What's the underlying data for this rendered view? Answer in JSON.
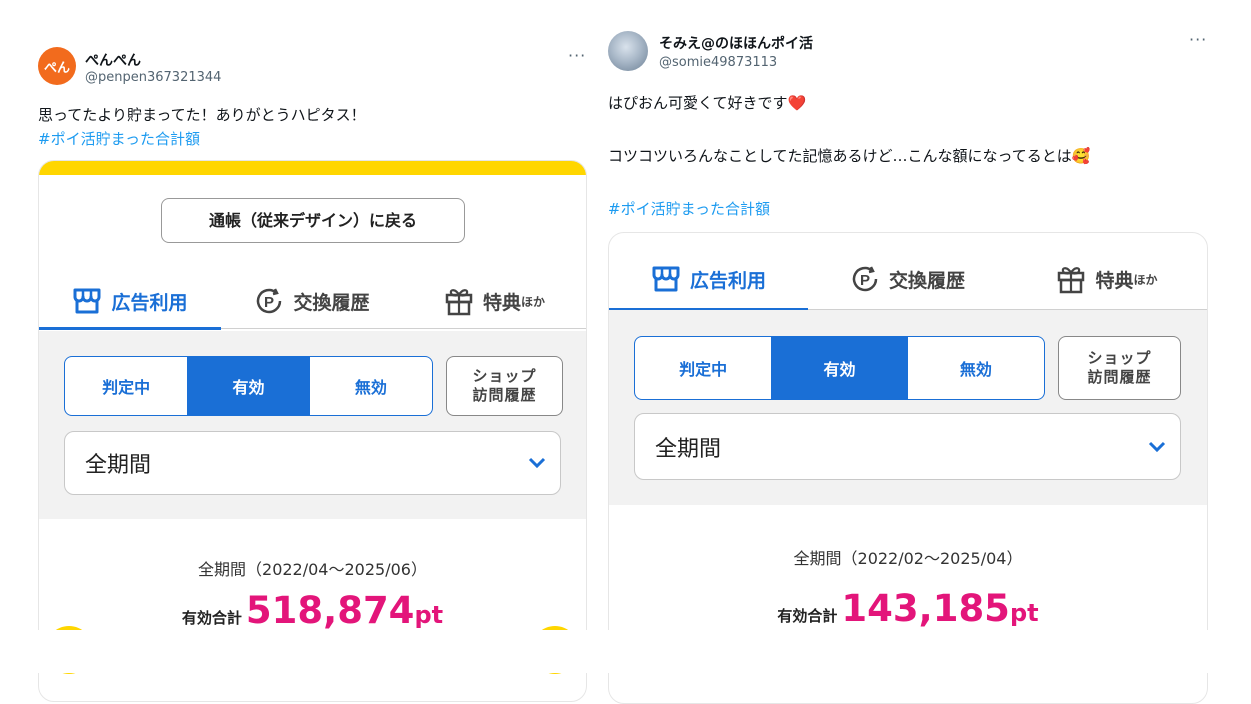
{
  "tweets": [
    {
      "author": {
        "name": "ぺんぺん",
        "handle": "@penpen367321344",
        "avatar_text": "ぺん",
        "avatar_color": "#f26b1d"
      },
      "text_lines": [
        "思ってたより貯まってた！ありがとうハピタス！"
      ],
      "hashtag": "#ポイ活貯まった合計額",
      "more_label": "···",
      "card": {
        "back_button": "通帳（従来デザイン）に戻る",
        "tabs": [
          {
            "label": "広告利用",
            "icon": "shop-icon",
            "active": true
          },
          {
            "label": "交換履歴",
            "icon": "point-exchange-icon",
            "active": false
          },
          {
            "label": "特典",
            "suffix": "ほか",
            "icon": "gift-icon",
            "active": false
          }
        ],
        "status_tabs": [
          {
            "label": "判定中",
            "active": false
          },
          {
            "label": "有効",
            "active": true
          },
          {
            "label": "無効",
            "active": false
          }
        ],
        "shop_history_lines": [
          "ショップ",
          "訪問履歴"
        ],
        "period_select": "全期間",
        "period_range": "全期間（2022/04～2025/06）",
        "total_label": "有効合計",
        "total_value": "518,874",
        "total_unit": "pt"
      }
    },
    {
      "author": {
        "name": "そみえ@のほほんポイ活",
        "handle": "@somie49873113",
        "avatar_text": "",
        "avatar_color": "#7f93a8"
      },
      "text_lines": [
        "はぴおん可愛くて好きです❤️",
        "",
        "コツコツいろんなことしてた記憶あるけど…こんな額になってるとは🥰"
      ],
      "hashtag": "#ポイ活貯まった合計額",
      "more_label": "···",
      "card": {
        "tabs": [
          {
            "label": "広告利用",
            "icon": "shop-icon",
            "active": true
          },
          {
            "label": "交換履歴",
            "icon": "point-exchange-icon",
            "active": false
          },
          {
            "label": "特典",
            "suffix": "ほか",
            "icon": "gift-icon",
            "active": false
          }
        ],
        "status_tabs": [
          {
            "label": "判定中",
            "active": false
          },
          {
            "label": "有効",
            "active": true
          },
          {
            "label": "無効",
            "active": false
          }
        ],
        "shop_history_lines": [
          "ショップ",
          "訪問履歴"
        ],
        "period_select": "全期間",
        "period_range": "全期間（2022/02～2025/04）",
        "total_label": "有効合計",
        "total_value": "143,185",
        "total_unit": "pt"
      }
    }
  ],
  "colors": {
    "accent": "#1a6fd6",
    "points": "#e3157a",
    "brand_yellow": "#ffd600",
    "hashtag": "#1d9bf0"
  }
}
